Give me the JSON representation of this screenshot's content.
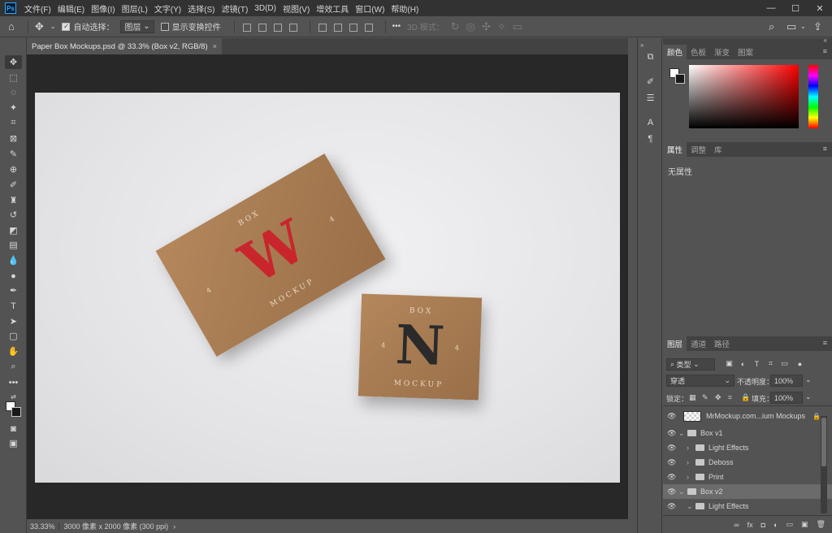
{
  "app": {
    "logo_text": "Ps"
  },
  "menubar": {
    "items": [
      "文件(F)",
      "编辑(E)",
      "图像(I)",
      "图层(L)",
      "文字(Y)",
      "选择(S)",
      "滤镜(T)",
      "3D(D)",
      "视图(V)",
      "增效工具",
      "窗口(W)",
      "帮助(H)"
    ]
  },
  "window_controls": {
    "minimize": "—",
    "maximize": "☐",
    "close": "✕"
  },
  "options": {
    "auto_select_label": "自动选择：",
    "auto_select_value": "图层",
    "show_transform_label": "显示变换控件",
    "mode_3d_label": "3D 模式：",
    "more": "•••"
  },
  "document": {
    "tab_title": "Paper Box Mockups.psd @ 33.3% (Box v2, RGB/8)",
    "close": "×",
    "zoom": "33.33%",
    "info": "3000 像素 x 2000 像素 (300 ppi)",
    "info_arrow": "›"
  },
  "mockup": {
    "left_box": {
      "top_word": "BOX",
      "bottom_word": "MOCKUP",
      "num": "4",
      "letter": "W"
    },
    "right_box": {
      "top_word": "BOX",
      "bottom_word": "MOCKUP",
      "num": "4",
      "letter": "N"
    }
  },
  "panels": {
    "color_tabs": [
      "颜色",
      "色板",
      "渐变",
      "图案"
    ],
    "props_tabs": [
      "属性",
      "调整",
      "库"
    ],
    "props_empty": "无属性",
    "layers_tabs": [
      "图层",
      "通道",
      "路径"
    ],
    "filter_kind": "类型",
    "blend_mode": "穿透",
    "opacity_label": "不透明度：",
    "opacity_value": "100%",
    "lock_label": "锁定：",
    "fill_label": "填充：",
    "fill_value": "100%"
  },
  "layers": [
    {
      "name": "MrMockup.com...ium Mockups",
      "type": "layer",
      "indent": 0,
      "locked": true
    },
    {
      "name": "Box v1",
      "type": "group",
      "indent": 0,
      "expanded": true
    },
    {
      "name": "Light Effects",
      "type": "group",
      "indent": 1,
      "expanded": false
    },
    {
      "name": "Deboss",
      "type": "group",
      "indent": 1,
      "expanded": false
    },
    {
      "name": "Print",
      "type": "group",
      "indent": 1,
      "expanded": false
    },
    {
      "name": "Box v2",
      "type": "group",
      "indent": 0,
      "expanded": true,
      "selected": true
    },
    {
      "name": "Light Effects",
      "type": "group",
      "indent": 1,
      "expanded": true
    }
  ],
  "layer_footer": [
    "∞",
    "fx",
    "◘",
    "◐",
    "▭",
    "▣",
    "🗑"
  ],
  "colors": {
    "accent": "#31a8ff",
    "red_ink": "#c8262c",
    "kraft": "#a67b52"
  }
}
